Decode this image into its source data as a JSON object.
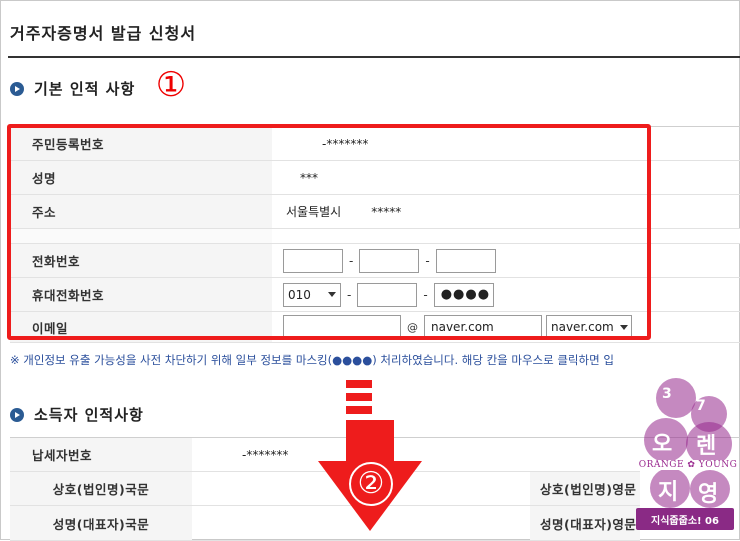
{
  "page": {
    "title": "거주자증명서 발급 신청서"
  },
  "section1": {
    "heading": "기본 인적 사항",
    "marker": "①",
    "rows": {
      "resident_no_label": "주민등록번호",
      "resident_no_value": "-*******",
      "name_label": "성명",
      "name_value": "***",
      "address_label": "주소",
      "address_city": "서울특별시",
      "address_rest": "*****",
      "phone_label": "전화번호",
      "phone_sep": "-",
      "mobile_label": "휴대전화번호",
      "mobile_prefix": "010",
      "mobile_last": "●●●●",
      "email_label": "이메일",
      "email_at": "@",
      "email_domain_text": "naver.com",
      "email_domain_select": "naver.com"
    }
  },
  "notice": "※ 개인정보 유출 가능성을 사전 차단하기 위해 일부 정보를 마스킹(●●●●) 처리하였습니다. 해당 칸을 마우스로 클릭하면 입",
  "section2": {
    "heading": "소득자 인적사항",
    "marker": "②",
    "rows": {
      "taxpayer_no_label": "납세자번호",
      "taxpayer_no_value": "-*******",
      "trade_name_kr_label": "상호(법인명)국문",
      "trade_name_en_label": "상호(법인명)영문",
      "rep_name_kr_label": "성명(대표자)국문",
      "rep_name_en_label": "성명(대표자)영문"
    }
  },
  "watermark": {
    "chars": [
      "오",
      "렌",
      "지",
      "영"
    ],
    "band": "ORANGE ✿ YOUNG",
    "nums": [
      "3",
      "7"
    ],
    "badge": "지식줍줍소! 06"
  },
  "colors": {
    "accent_red": "#ee1c1c",
    "bullet_blue": "#2b5b93",
    "notice_blue": "#2b4f9c"
  },
  "icons": {
    "bullet": "circle-arrow-right-icon",
    "down_arrow": "big-down-arrow-icon"
  }
}
